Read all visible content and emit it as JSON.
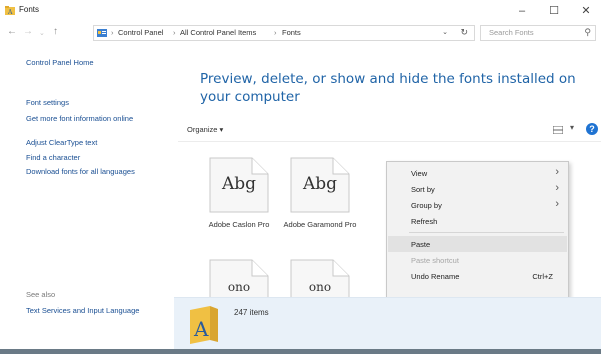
{
  "window": {
    "title": "Fonts",
    "minimize_glyph": "–",
    "maximize_glyph": "☐",
    "close_glyph": "✕"
  },
  "address": {
    "back_glyph": "←",
    "forward_glyph": "→",
    "up_glyph": "↑",
    "breadcrumbs": [
      "Control Panel",
      "All Control Panel Items",
      "Fonts"
    ],
    "separator": "›",
    "dropdown_glyph": "⌄",
    "refresh_glyph": "↻"
  },
  "search": {
    "placeholder": "Search Fonts",
    "icon": "search-icon"
  },
  "sidebar": {
    "home": "Control Panel Home",
    "links": [
      "Font settings",
      "Get more font information online",
      "Adjust ClearType text",
      "Find a character",
      "Download fonts for all languages"
    ],
    "see_also_title": "See also",
    "see_also_links": [
      "Text Services and Input Language"
    ]
  },
  "main": {
    "heading": "Preview, delete, or show and hide the fonts installed on your computer",
    "organize_label": "Organize ▾",
    "view_dd_glyph": "▾",
    "help_glyph": "?"
  },
  "fonts": [
    {
      "preview": "Abg",
      "name": "Adobe Caslon Pro"
    },
    {
      "preview": "Abg",
      "name": "Adobe Garamond Pro"
    },
    {
      "preview": "ono",
      "name": ""
    },
    {
      "preview": "ono",
      "name": ""
    }
  ],
  "context_menu": {
    "items": [
      {
        "label": "View",
        "submenu": true,
        "shortcut": "",
        "disabled": false
      },
      {
        "label": "Sort by",
        "submenu": true,
        "shortcut": "",
        "disabled": false
      },
      {
        "label": "Group by",
        "submenu": true,
        "shortcut": "",
        "disabled": false
      },
      {
        "label": "Refresh",
        "submenu": false,
        "shortcut": "",
        "disabled": false
      },
      {
        "label": "Paste",
        "submenu": false,
        "shortcut": "",
        "disabled": false
      },
      {
        "label": "Paste shortcut",
        "submenu": false,
        "shortcut": "",
        "disabled": true
      },
      {
        "label": "Undo Rename",
        "submenu": false,
        "shortcut": "Ctrl+Z",
        "disabled": false
      }
    ],
    "submenu_glyph": "›"
  },
  "details": {
    "item_count": "247 items"
  },
  "colors": {
    "link": "#1a4f93",
    "heading": "#2064a7",
    "details_bg": "#e9f1f9",
    "menu_bg": "#f2f2f2",
    "menu_highlight": "#e2e2e2",
    "folder_yellow": "#f0c043"
  }
}
